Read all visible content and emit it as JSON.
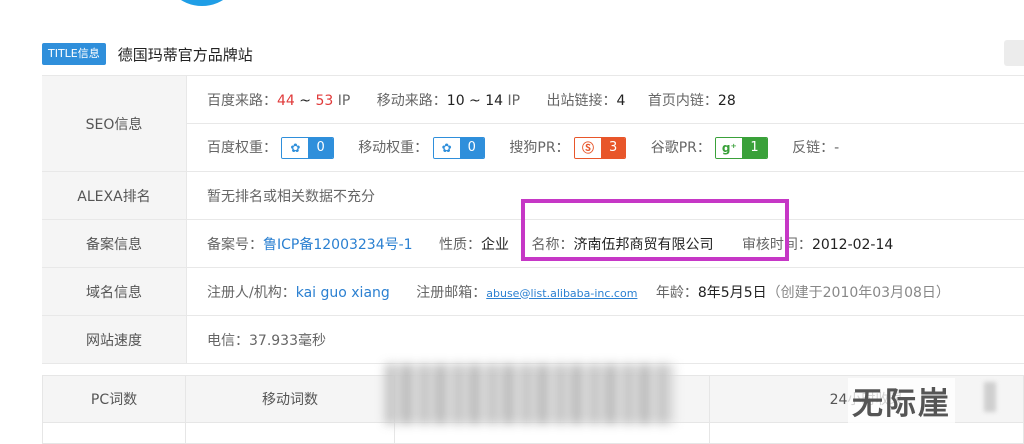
{
  "title": {
    "tag": "TITLE信息",
    "text": "德国玛蒂官方品牌站"
  },
  "rows": {
    "seo": {
      "label": "SEO信息",
      "baidu_src_k": "百度来路：",
      "baidu_src_a": "44",
      "baidu_src_s": " ~ ",
      "baidu_src_b": "53",
      "baidu_src_u": " IP",
      "mobile_src_k": "移动来路：",
      "mobile_src_v": "10 ~ 14",
      "mobile_src_u": " IP",
      "outlinks_k": "出站链接：",
      "outlinks_v": "4",
      "inlinks_k": "首页内链：",
      "inlinks_v": "28",
      "baidu_w_k": "百度权重：",
      "baidu_w_v": "0",
      "mobile_w_k": "移动权重：",
      "mobile_w_v": "0",
      "sogou_k": "搜狗PR：",
      "sogou_v": "3",
      "google_k": "谷歌PR：",
      "google_v": "1",
      "backlinks_k": "反链：",
      "backlinks_v": "-"
    },
    "alexa": {
      "label": "ALEXA排名",
      "text": "暂无排名或相关数据不充分"
    },
    "icp": {
      "label": "备案信息",
      "no_k": "备案号：",
      "no_v": "鲁ICP备12003234号-1",
      "type_k": "性质：",
      "type_v": "企业",
      "name_k": "名称：",
      "name_v": "济南伍邦商贸有限公司",
      "date_k": "审核时间：",
      "date_v": "2012-02-14"
    },
    "domain": {
      "label": "域名信息",
      "owner_k": "注册人/机构：",
      "owner_v": "kai guo xiang",
      "email_k": "注册邮箱：",
      "email_v": "abuse@list.alibaba-inc.com",
      "age_k": "年龄：",
      "age_v": "8年5月5日",
      "age_note": "（创建于2010年03月08日）"
    },
    "speed": {
      "label": "网站速度",
      "text": "电信：37.933毫秒"
    }
  },
  "words": {
    "headers": [
      "PC词数",
      "移动词数",
      "",
      "24小时收录"
    ]
  },
  "watermark": "无际崖",
  "colors": {
    "accent": "#2f8fdb",
    "highlight": "#c637c6",
    "red": "#e03a3a",
    "link": "#2b80d1"
  },
  "icons": [
    "paw-icon",
    "sogou-icon",
    "google-plus-icon"
  ]
}
